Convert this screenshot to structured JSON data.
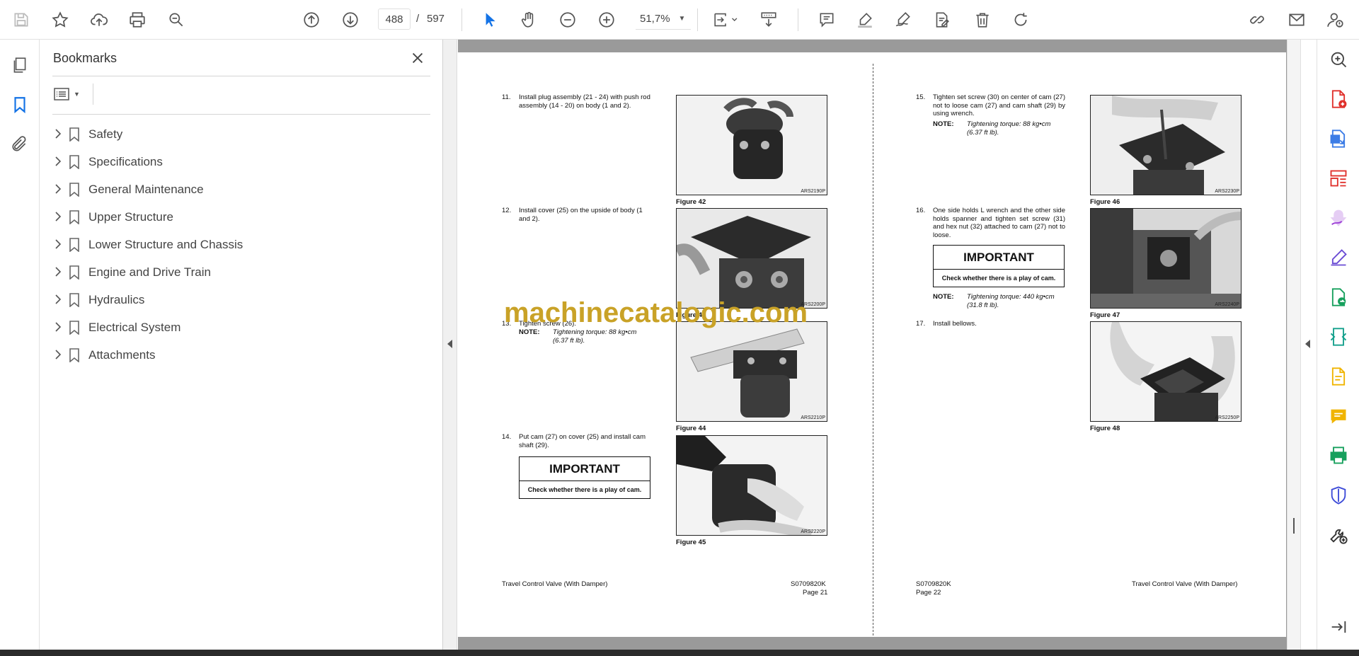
{
  "toolbar": {
    "icons": [
      "save-icon",
      "bookmark-star-icon",
      "upload-icon",
      "print-icon",
      "find-icon",
      "prev-page-icon",
      "next-page-icon",
      "select-cursor-icon",
      "hand-tool-icon",
      "zoom-out-icon",
      "zoom-in-icon",
      "fit-page-icon",
      "scroll-mode-icon",
      "comment-icon",
      "highlight-icon",
      "sign-icon",
      "fill-sign-icon",
      "delete-icon",
      "rotate-icon",
      "share-link-icon",
      "email-icon",
      "account-icon"
    ],
    "current_page": "488",
    "page_separator": "/",
    "total_pages": "597",
    "zoom": "51,7%",
    "accent_color": "#1473e6"
  },
  "bookmarks": {
    "title": "Bookmarks",
    "items": [
      {
        "label": "Safety"
      },
      {
        "label": "Specifications"
      },
      {
        "label": "General Maintenance"
      },
      {
        "label": "Upper Structure"
      },
      {
        "label": "Lower Structure and Chassis"
      },
      {
        "label": "Engine and Drive Train"
      },
      {
        "label": "Hydraulics"
      },
      {
        "label": "Electrical System"
      },
      {
        "label": "Attachments"
      }
    ]
  },
  "document": {
    "left_page": {
      "steps": [
        {
          "num": "11.",
          "text": "Install plug assembly (21 - 24) with push rod assembly (14 - 20) on body (1 and 2)."
        },
        {
          "num": "12.",
          "text": "Install cover (25) on the upside of body (1 and 2)."
        },
        {
          "num": "13.",
          "text": "Tighten screw (26)."
        },
        {
          "num": "14.",
          "text": "Put cam (27) on cover (25) and install cam shaft (29)."
        }
      ],
      "note_label": "NOTE:",
      "note_text": "Tightening torque: 88 kg•cm (6.37 ft lb).",
      "important_head": "IMPORTANT",
      "important_body": "Check whether there is a play of cam.",
      "figures": [
        {
          "code": "ARS2190P",
          "caption": "Figure 42"
        },
        {
          "code": "ARS2200P",
          "caption": "Figure 43"
        },
        {
          "code": "ARS2210P",
          "caption": "Figure 44"
        },
        {
          "code": "ARS2220P",
          "caption": "Figure 45"
        }
      ],
      "footer_left": "Travel Control Valve (With Damper)",
      "footer_code": "S0709820K",
      "footer_page": "Page 21"
    },
    "right_page": {
      "steps": [
        {
          "num": "15.",
          "text": "Tighten set screw (30) on center of cam (27) not to loose cam (27) and cam shaft (29) by using wrench."
        },
        {
          "num": "16.",
          "text": "One side holds L wrench and the other side holds spanner and tighten set screw (31) and hex nut (32) attached to cam (27) not to loose."
        },
        {
          "num": "17.",
          "text": "Install bellows."
        }
      ],
      "note1_label": "NOTE:",
      "note1_text": "Tightening torque: 88 kg•cm (6.37 ft lb).",
      "note2_label": "NOTE:",
      "note2_text": "Tightening torque: 440 kg•cm (31.8 ft lb).",
      "important_head": "IMPORTANT",
      "important_body": "Check whether there is a play of cam.",
      "figures": [
        {
          "code": "ARS2230P",
          "caption": "Figure 46"
        },
        {
          "code": "ARS2240P",
          "caption": "Figure 47"
        },
        {
          "code": "ARS2250P",
          "caption": "Figure 48"
        }
      ],
      "footer_code": "S0709820K",
      "footer_page": "Page 22",
      "footer_right": "Travel Control Valve (With Damper)"
    },
    "watermark": "machinecatalogic.com"
  },
  "right_tools": {
    "icons": [
      "zoom-search-icon",
      "create-pdf-icon",
      "export-pdf-icon",
      "organize-pages-icon",
      "fill-sign-tool-icon",
      "edit-pdf-icon",
      "convert-pdf-icon",
      "compress-pdf-icon",
      "document-icon",
      "comment-tool-icon",
      "print-production-icon",
      "protect-icon",
      "more-tools-icon",
      "expand-panel-icon"
    ],
    "colors": [
      "#e0312c",
      "#3d7de6",
      "#e0312c",
      "#9c3ed6",
      "#6a4bd4",
      "#17a05d",
      "#14a08c",
      "#f0b400",
      "#f0b400",
      "#17a05d",
      "#3d4bd8",
      "#333333"
    ]
  }
}
